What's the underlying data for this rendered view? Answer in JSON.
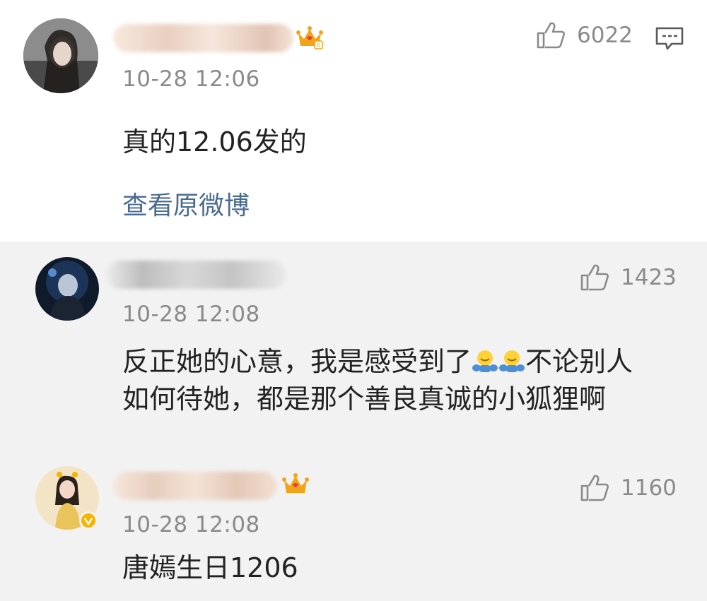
{
  "comments": [
    {
      "time": "10-28 12:06",
      "text": "真的12.06发的",
      "likes": "6022",
      "view_original": "查看原微博"
    },
    {
      "time": "10-28 12:08",
      "text_line1_a": "反正她的心意，我是感受到了",
      "text_line1_b": "不论别人",
      "text_line2": "如何待她，都是那个善良真诚的小狐狸啊",
      "likes": "1423"
    },
    {
      "time": "10-28 12:08",
      "text": "唐嫣生日1206",
      "likes": "1160"
    }
  ],
  "icons": {
    "like": "thumbs-up-icon",
    "reply": "comment-icon",
    "badge": "crown-icon",
    "emoji": "hug-emoji"
  },
  "colors": {
    "link": "#4a6b91",
    "meta": "#8a8a8a",
    "crown": "#f2a418",
    "verified": "#f6b400"
  }
}
